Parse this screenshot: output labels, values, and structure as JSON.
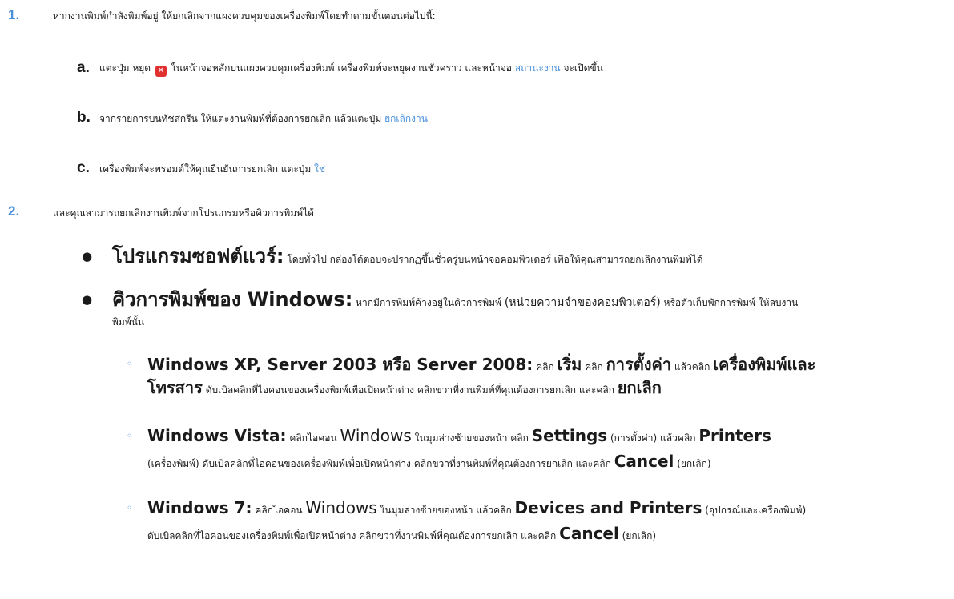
{
  "steps": {
    "s1": {
      "num": "1.",
      "text": "หากงานพิมพ์กำลังพิมพ์อยู่ ให้ยกเลิกจากแผงควบคุมของเครื่องพิมพ์โดยทำตามขั้นตอนต่อไปนี้:",
      "a": {
        "letter": "a.",
        "pre": "แตะปุ่ม หยุด",
        "mid": "ในหน้าจอหลักบนแผงควบคุมเครื่องพิมพ์ เครื่องพิมพ์จะหยุดงานชั่วคราว และหน้าจอ",
        "link": "สถานะงาน",
        "post": "จะเปิดขึ้น"
      },
      "b": {
        "letter": "b.",
        "pre": "จากรายการบนทัชสกรีน ให้แตะงานพิมพ์ที่ต้องการยกเลิก แล้วแตะปุ่ม",
        "link": "ยกเลิกงาน"
      },
      "c": {
        "letter": "c.",
        "pre": "เครื่องพิมพ์จะพรอมต์ให้คุณยืนยันการยกเลิก แตะปุ่ม",
        "link": "ใช่"
      }
    },
    "s2": {
      "num": "2.",
      "text": "และคุณสามารถยกเลิกงานพิมพ์จากโปรแกรมหรือคิวการพิมพ์ได้",
      "bullet1": {
        "head": "โปรแกรมซอฟต์แวร์:",
        "text": "โดยทั่วไป กล่องโต้ตอบจะปรากฏขึ้นชั่วครู่บนหน้าจอคอมพิวเตอร์ เพื่อให้คุณสามารถยกเลิกงานพิมพ์ได้"
      },
      "bullet2": {
        "head": "คิวการพิมพ์ของ Windows:",
        "text1": "หากมีการพิมพ์ค้างอยู่ในคิวการพิมพ์",
        "paren": "(หน่วยความจำของคอมพิวเตอร์)",
        "text2": "หรือตัวเก็บพักการพิมพ์ ให้ลบงาน",
        "text3": "พิมพ์นั้น"
      },
      "xp": {
        "head": "Windows XP, Server 2003 หรือ Server 2008:",
        "t1": "คลิก",
        "b1": "เริ่ม",
        "t2": "คลิก",
        "b2": "การตั้งค่า",
        "t3": "แล้วคลิก",
        "b3": "เครื่องพิมพ์และ",
        "b4": "โทรสาร",
        "t4": "ดับเบิลคลิกที่ไอคอนของเครื่องพิมพ์เพื่อเปิดหน้าต่าง คลิกขวาที่งานพิมพ์ที่คุณต้องการยกเลิก และคลิก",
        "b5": "ยกเลิก"
      },
      "vista": {
        "head": "Windows Vista:",
        "t1": "คลิกไอคอน",
        "w": "Windows",
        "t2": "ในมุมล่างซ้ายของหน้า คลิก",
        "b1": "Settings",
        "t3": "(การตั้งค่า) แล้วคลิก",
        "b2": "Printers",
        "t4": "(เครื่องพิมพ์) ดับเบิลคลิกที่ไอคอนของเครื่องพิมพ์เพื่อเปิดหน้าต่าง คลิกขวาที่งานพิมพ์ที่คุณต้องการยกเลิก และคลิก",
        "b3": "Cancel",
        "t5": "(ยกเลิก)"
      },
      "win7": {
        "head": "Windows 7:",
        "t1": "คลิกไอคอน",
        "w": "Windows",
        "t2": "ในมุมล่างซ้ายของหน้า แล้วคลิก",
        "b1": "Devices and Printers",
        "t3": "(อุปกรณ์และเครื่องพิมพ์)",
        "t4": "ดับเบิลคลิกที่ไอคอนของเครื่องพิมพ์เพื่อเปิดหน้าต่าง คลิกขวาที่งานพิมพ์ที่คุณต้องการยกเลิก และคลิก",
        "b2": "Cancel",
        "t5": "(ยกเลิก)"
      }
    }
  },
  "colors": {
    "accent": "#4a90d9",
    "stop": "#e03030"
  },
  "icons": {
    "stop": "stop-x-icon",
    "bullet": "bullet-dot",
    "circle": "sub-bullet-circle"
  }
}
